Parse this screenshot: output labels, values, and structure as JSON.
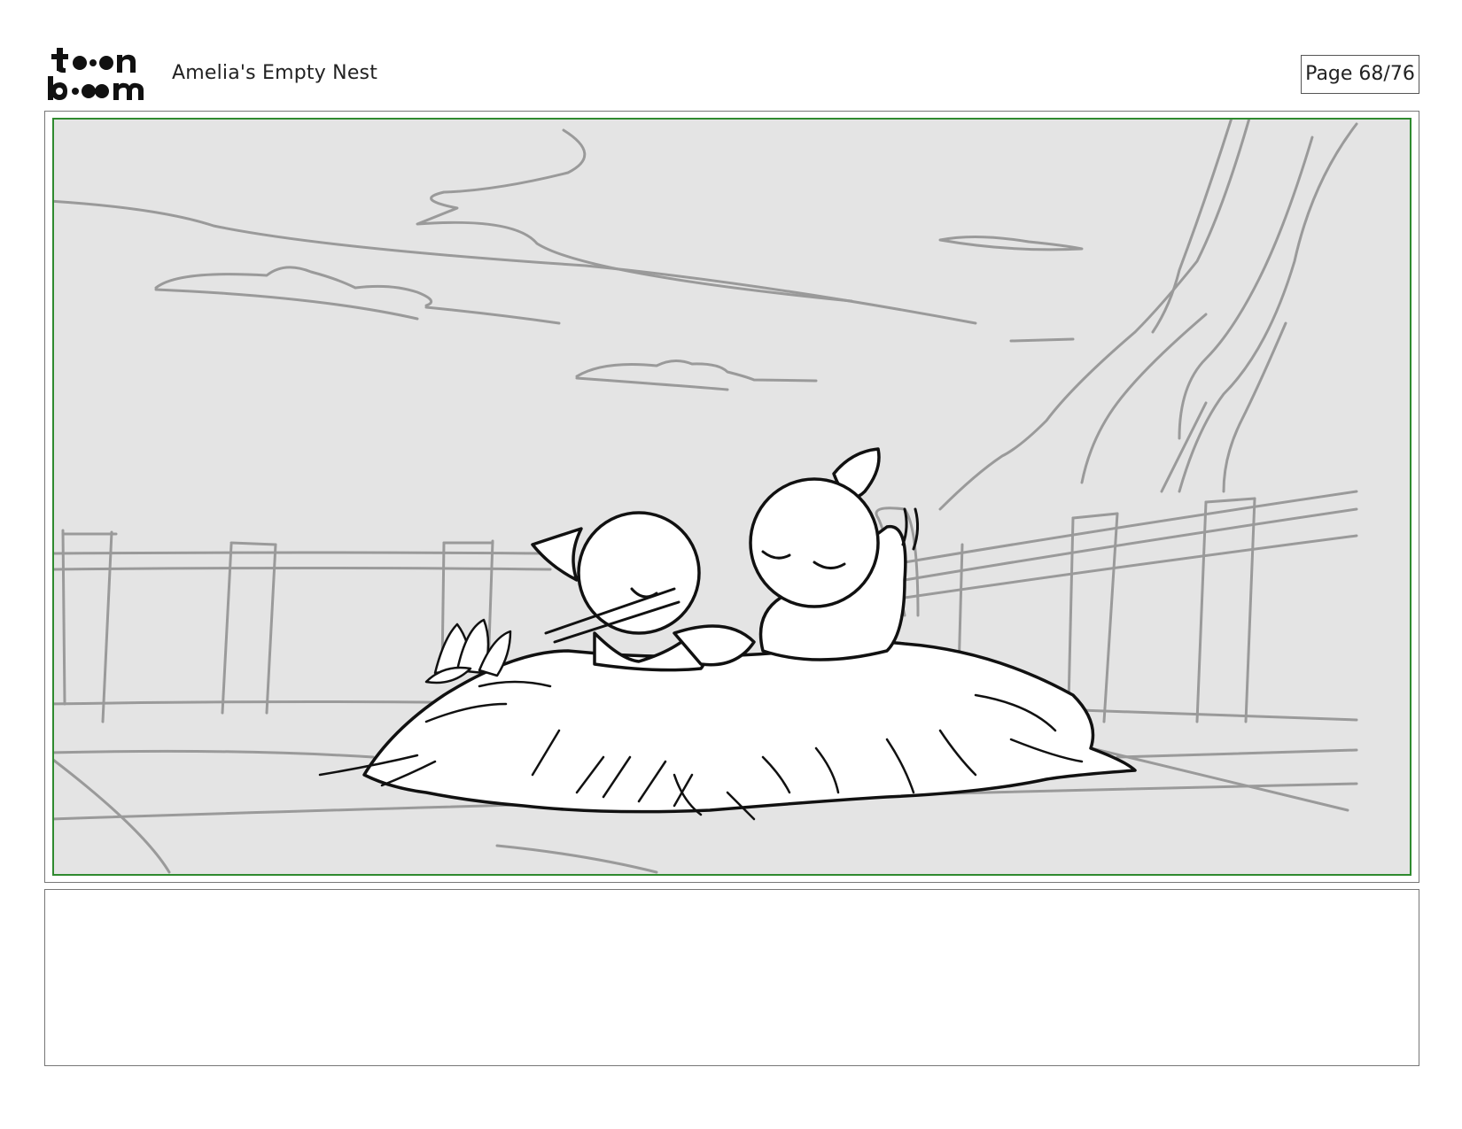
{
  "header": {
    "logo_text": [
      "to•n",
      "b••m"
    ],
    "title": "Amelia's Empty Nest",
    "page_indicator": "Page 68/76"
  },
  "panel": {
    "frame_color": "#2f8a2f",
    "background_color": "#e4e4e4"
  },
  "notes": {
    "text": ""
  }
}
